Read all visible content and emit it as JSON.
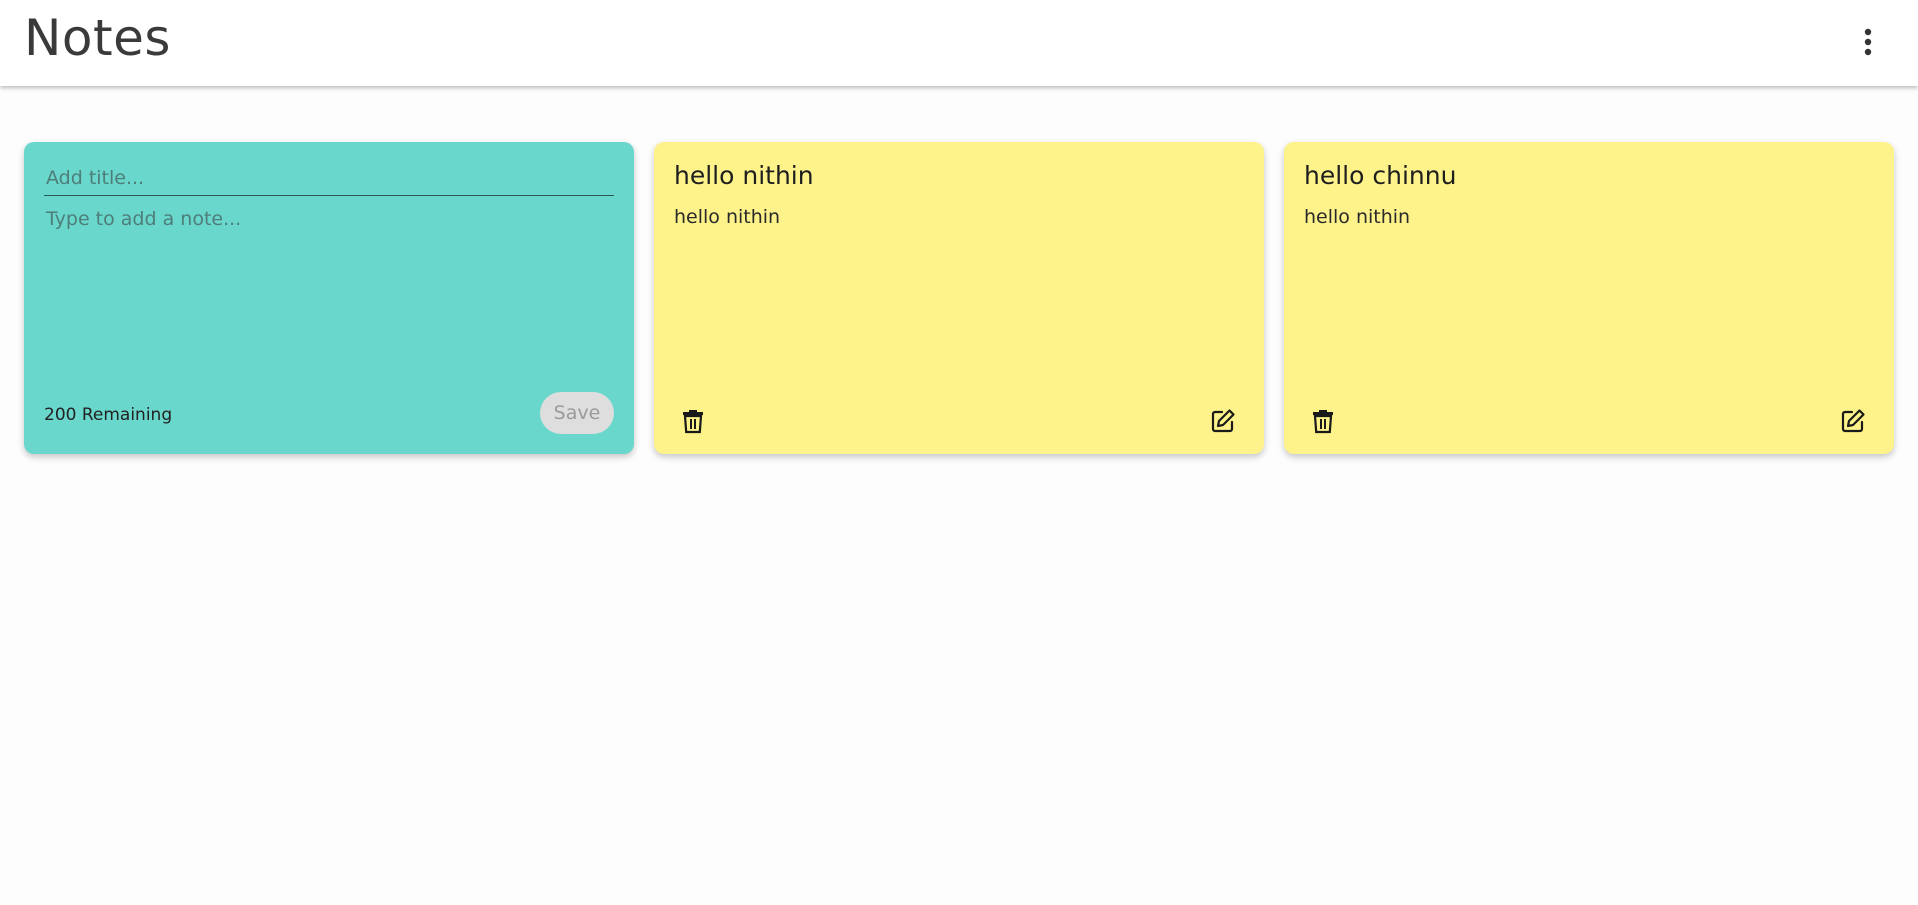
{
  "app": {
    "title": "Notes"
  },
  "header": {
    "menu_icon": "more-vert-icon"
  },
  "new_note": {
    "title_placeholder": "Add title...",
    "body_placeholder": "Type to add a note...",
    "remaining": "200 Remaining",
    "save_label": "Save",
    "color": "#69d7cb"
  },
  "notes": [
    {
      "title": "hello nithin",
      "body": "hello nithin",
      "color": "#fdf38a",
      "delete_icon": "trash-icon",
      "edit_icon": "edit-icon"
    },
    {
      "title": "hello chinnu",
      "body": "hello nithin",
      "color": "#fdf38a",
      "delete_icon": "trash-icon",
      "edit_icon": "edit-icon"
    }
  ]
}
